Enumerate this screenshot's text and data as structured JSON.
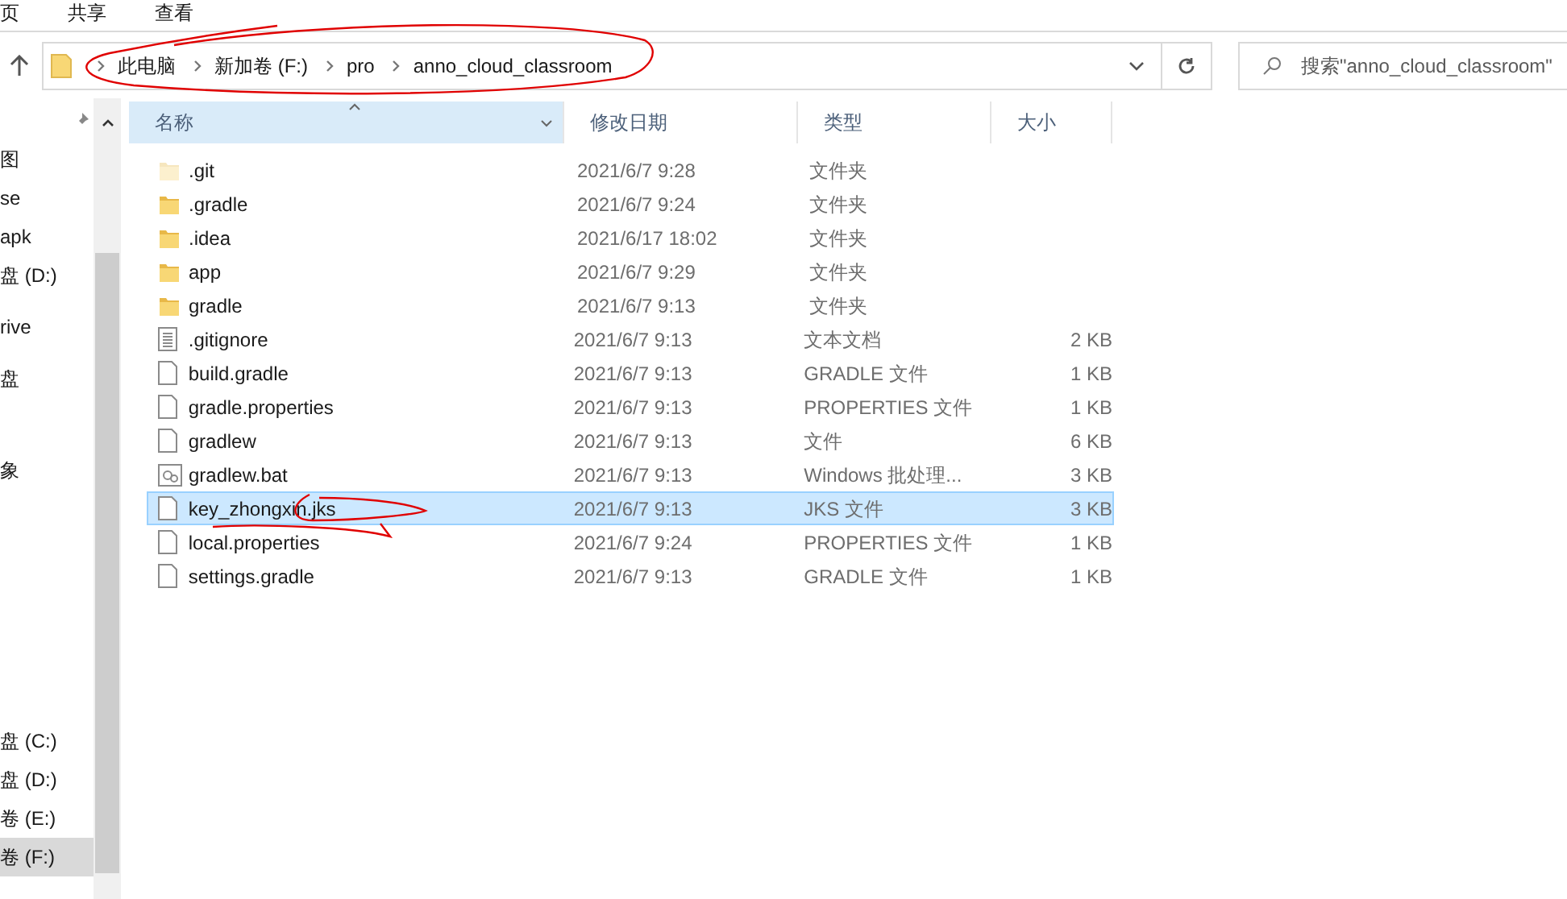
{
  "ribbon_tabs": [
    {
      "label": "页"
    },
    {
      "label": "共享"
    },
    {
      "label": "查看"
    }
  ],
  "address_bar": {
    "segments": [
      "此电脑",
      "新加卷 (F:)",
      "pro",
      "anno_cloud_classroom"
    ]
  },
  "search": {
    "placeholder": "搜索\"anno_cloud_classroom\""
  },
  "nav_pane": {
    "groups": [
      {
        "items": [
          {
            "label": "图",
            "selected": false
          },
          {
            "label": "se",
            "selected": false
          },
          {
            "label": "apk",
            "selected": false
          },
          {
            "label": "盘 (D:)",
            "selected": false
          },
          {
            "label": "rive",
            "selected": false
          },
          {
            "label": "盘",
            "selected": false
          },
          {
            "label": "象",
            "selected": false
          }
        ]
      },
      {
        "items": [
          {
            "label": "盘 (C:)",
            "selected": false
          },
          {
            "label": "盘 (D:)",
            "selected": false
          },
          {
            "label": "卷 (E:)",
            "selected": false
          },
          {
            "label": "卷 (F:)",
            "selected": true
          }
        ]
      }
    ]
  },
  "table": {
    "columns": [
      "名称",
      "修改日期",
      "类型",
      "大小"
    ],
    "rows": [
      {
        "kind": "hidden_folder",
        "name": ".git",
        "date": "2021/6/7 9:28",
        "type": "文件夹",
        "selected": false
      },
      {
        "kind": "folder",
        "name": ".gradle",
        "date": "2021/6/7 9:24",
        "type": "文件夹",
        "selected": false
      },
      {
        "kind": "folder",
        "name": ".idea",
        "date": "2021/6/17 18:02",
        "type": "文件夹",
        "selected": false
      },
      {
        "kind": "folder",
        "name": "app",
        "date": "2021/6/7 9:29",
        "type": "文件夹",
        "selected": false
      },
      {
        "kind": "folder",
        "name": "gradle",
        "date": "2021/6/7 9:13",
        "type": "文件夹",
        "selected": false
      },
      {
        "kind": "text",
        "name": ".gitignore",
        "date": "2021/6/7 9:13",
        "type": "文本文档",
        "size": "2 KB",
        "selected": false
      },
      {
        "kind": "file",
        "name": "build.gradle",
        "date": "2021/6/7 9:13",
        "type": "GRADLE 文件",
        "size": "1 KB",
        "selected": false
      },
      {
        "kind": "file",
        "name": "gradle.properties",
        "date": "2021/6/7 9:13",
        "type": "PROPERTIES 文件",
        "size": "1 KB",
        "selected": false
      },
      {
        "kind": "file",
        "name": "gradlew",
        "date": "2021/6/7 9:13",
        "type": "文件",
        "size": "6 KB",
        "selected": false
      },
      {
        "kind": "batch",
        "name": "gradlew.bat",
        "date": "2021/6/7 9:13",
        "type": "Windows 批处理...",
        "size": "3 KB",
        "selected": false
      },
      {
        "kind": "file",
        "name": "key_zhongxin.jks",
        "date": "2021/6/7 9:13",
        "type": "JKS 文件",
        "size": "3 KB",
        "selected": true
      },
      {
        "kind": "file",
        "name": "local.properties",
        "date": "2021/6/7 9:24",
        "type": "PROPERTIES 文件",
        "size": "1 KB",
        "selected": false
      },
      {
        "kind": "file",
        "name": "settings.gradle",
        "date": "2021/6/7 9:13",
        "type": "GRADLE 文件",
        "size": "1 KB",
        "selected": false
      }
    ]
  }
}
